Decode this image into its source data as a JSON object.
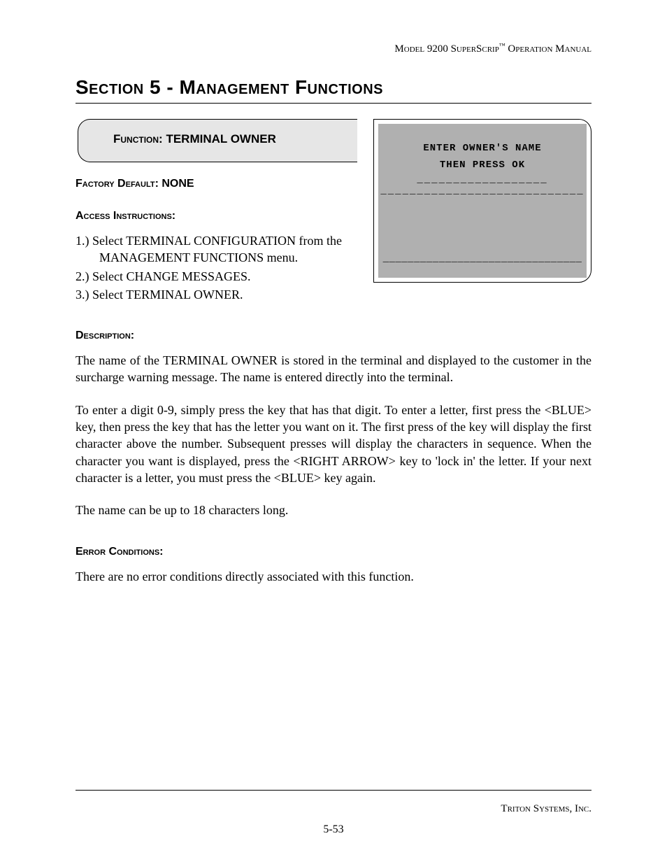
{
  "header": {
    "model": "Model 9200 SuperScrip",
    "tm": "™",
    "suffix": " Operation Manual"
  },
  "section_title": "Section 5 - Management Functions",
  "function_box": {
    "label": "Function:",
    "name": "TERMINAL OWNER"
  },
  "factory_default": {
    "label": "Factory Default:",
    "value": "NONE"
  },
  "access_instructions_label": "Access Instructions:",
  "instructions": [
    "1.) Select TERMINAL CONFIGURATION from the MANAGEMENT FUNCTIONS menu.",
    "2.) Select CHANGE MESSAGES.",
    "3.) Select TERMINAL OWNER."
  ],
  "description_label": "Description:",
  "description_paragraphs": [
    "The name of the TERMINAL OWNER is stored in the terminal and displayed to the customer in the surcharge warning message.  The name is entered directly into the terminal.",
    "To enter a digit 0-9, simply press the key that has that digit.  To enter a letter, first press the <BLUE> key, then press the key that has the letter you want on it.  The first press of the key will display the first character above the number.  Subsequent presses will display the characters in sequence.  When the character you want is displayed, press the <RIGHT ARROW> key to 'lock in' the letter.  If your next character is a letter, you must press the <BLUE> key again.",
    "The name can be up to 18 characters long."
  ],
  "error_conditions_label": "Error Conditions:",
  "error_conditions_text": "There are no error conditions directly associated with this function.",
  "screen": {
    "line1": "ENTER OWNER'S NAME",
    "line2": "THEN PRESS OK",
    "underscore1": "__________________",
    "underscore2": "____________________________",
    "underscore3": "________________________________"
  },
  "footer": {
    "company": "Triton Systems, Inc.",
    "page": "5-53"
  }
}
